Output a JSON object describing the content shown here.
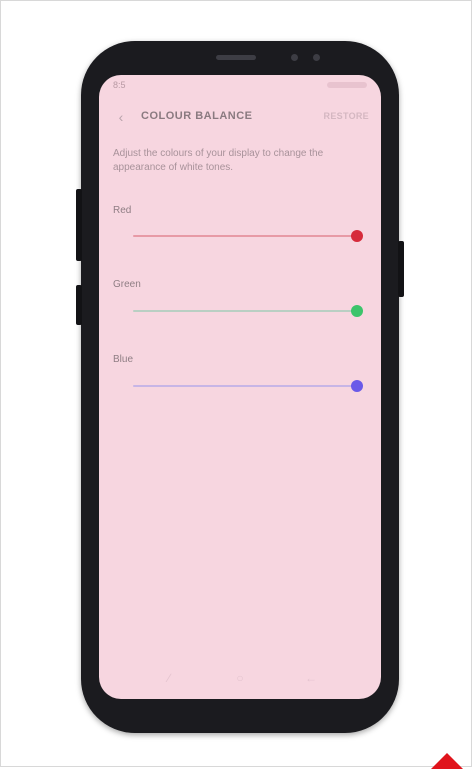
{
  "status_bar": {
    "left_text": "8:5"
  },
  "app_bar": {
    "title": "COLOUR BALANCE",
    "restore_label": "RESTORE"
  },
  "description": "Adjust the colours of your display to change the appearance of white tones.",
  "sliders": [
    {
      "label": "Red",
      "value": 1.0,
      "thumb_color": "#d62b3b",
      "track_color": "#e79aa6"
    },
    {
      "label": "Green",
      "value": 1.0,
      "thumb_color": "#3cc46b",
      "track_color": "#b9cfc3"
    },
    {
      "label": "Blue",
      "value": 1.0,
      "thumb_color": "#6a5ae8",
      "track_color": "#c7b5e6"
    }
  ],
  "nav_bar": {
    "recent_icon": "recent-apps-icon",
    "home_icon": "home-icon",
    "back_icon": "back-icon"
  },
  "colors": {
    "screen_background": "#f7d6e0",
    "phone_body": "#1b1b1f"
  }
}
